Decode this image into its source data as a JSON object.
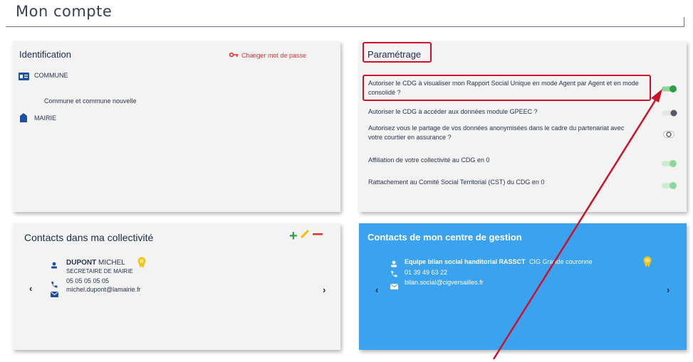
{
  "page": {
    "title": "Mon compte"
  },
  "identification": {
    "title": "Identification",
    "change_password": "Changer mot de passe",
    "commune_label": "COMMUNE",
    "commune_type": "Commune et commune nouvelle",
    "mairie_label": "MAIRIE"
  },
  "settings": {
    "title": "Paramétrage",
    "items": [
      {
        "label": "Autoriser le CDG à visualiser mon Rapport Social Unique en mode Agent par Agent et en mode consolidé ?",
        "state": "on"
      },
      {
        "label": "Autoriser le CDG à accéder aux données module GPEEC ?",
        "state": "off"
      },
      {
        "label": "Autorisez vous le partage de vos données anonymisées dans le cadre du partenariat avec votre courtier en assurance ?",
        "state": "unset"
      },
      {
        "label": "Affiliation de votre collectivité au CDG en 0",
        "state": "on-disabled"
      },
      {
        "label": "Rattachement au Comité Social Territorial (CST) du CDG en 0",
        "state": "on-disabled"
      }
    ]
  },
  "contacts_collectivite": {
    "title": "Contacts dans ma collectivité",
    "contact": {
      "last_name": "DUPONT",
      "first_name": "MICHEL",
      "role": "SECRETAIRE DE MAIRIE",
      "phone": "05 05 05 05 05",
      "email": "michel.dupont@lamairie.fr"
    },
    "prev": "‹",
    "next": "›"
  },
  "contacts_centre": {
    "title": "Contacts de mon centre de gestion",
    "contact": {
      "name": "Equipe bilan social handitorial RASSCT",
      "org": "CIG Grande couronne",
      "phone": "01 39 49 63 22",
      "email": "bilan.social@cigversailles.fr"
    },
    "prev": "‹",
    "next": "›"
  },
  "colors": {
    "accent_blue": "#3aa2ee",
    "icon_blue": "#1f4fa0",
    "toggle_green": "#2e9e47",
    "toggle_green_light": "#8fd69a",
    "annotation_red": "#d0102a",
    "change_pwd_red": "#e0302e"
  }
}
